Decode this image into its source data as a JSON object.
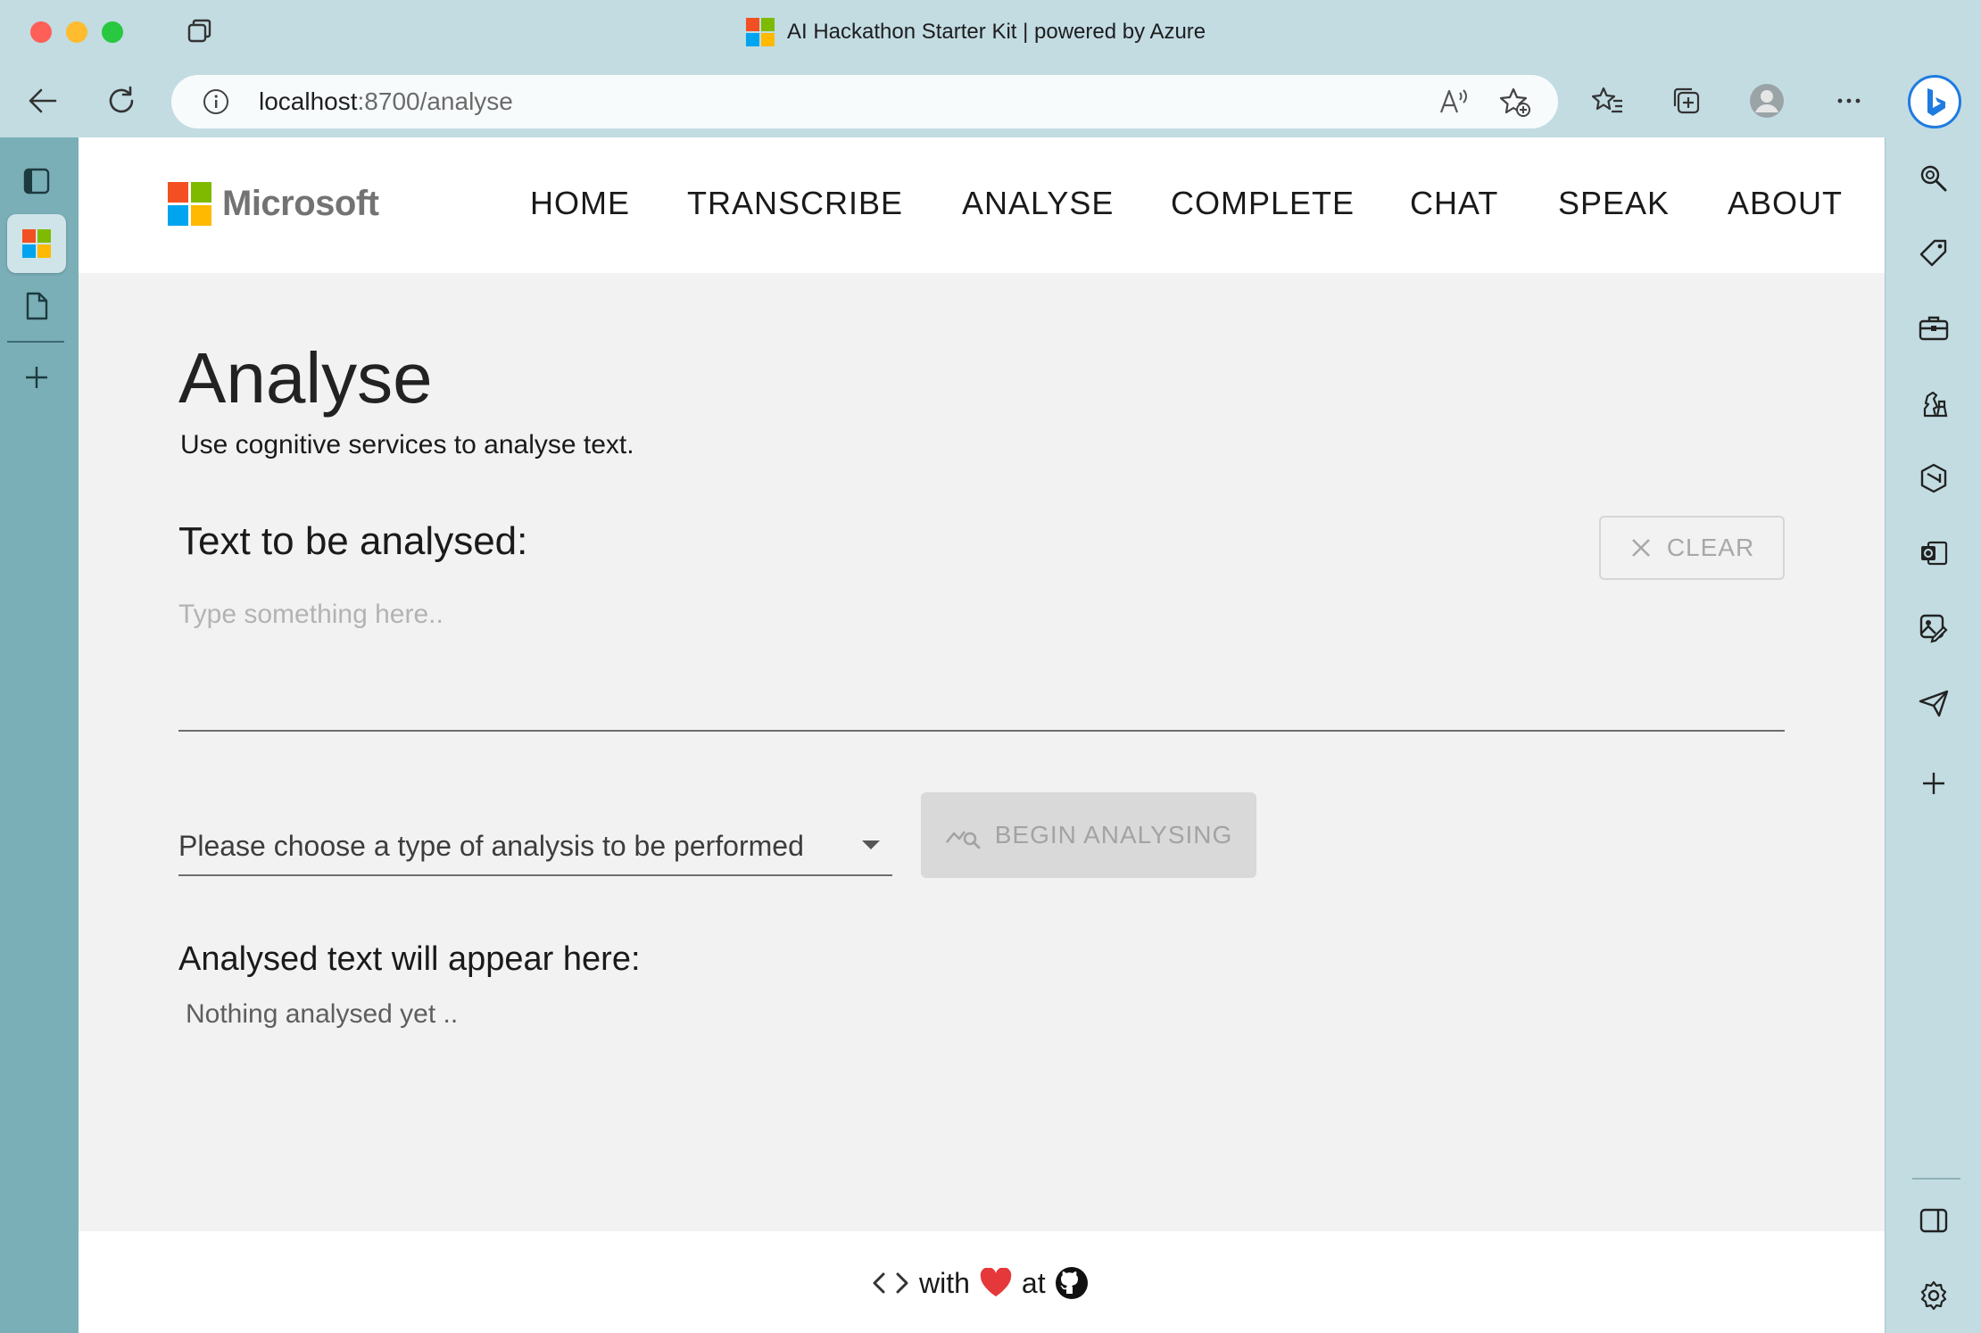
{
  "browser": {
    "window_title": "AI Hackathon Starter Kit | powered by Azure",
    "url_host": "localhost",
    "url_rest": ":8700/analyse"
  },
  "site": {
    "logo_text": "Microsoft",
    "nav": [
      "HOME",
      "TRANSCRIBE",
      "ANALYSE",
      "COMPLETE",
      "CHAT",
      "SPEAK",
      "ABOUT"
    ]
  },
  "page": {
    "title": "Analyse",
    "subtitle": "Use cognitive services to analyse text.",
    "input_label": "Text to be analysed:",
    "clear_label": "CLEAR",
    "input_placeholder": "Type something here..",
    "select_placeholder": "Please choose a type of analysis to be performed",
    "begin_label": "BEGIN ANALYSING",
    "result_label": "Analysed text will appear here:",
    "result_text": "Nothing analysed yet .."
  },
  "footer": {
    "with": "with",
    "at": "at"
  },
  "colors": {
    "ms_red": "#f25022",
    "ms_green": "#7fba00",
    "ms_blue": "#00a4ef",
    "ms_yellow": "#ffb900",
    "heart": "#e5383b"
  }
}
